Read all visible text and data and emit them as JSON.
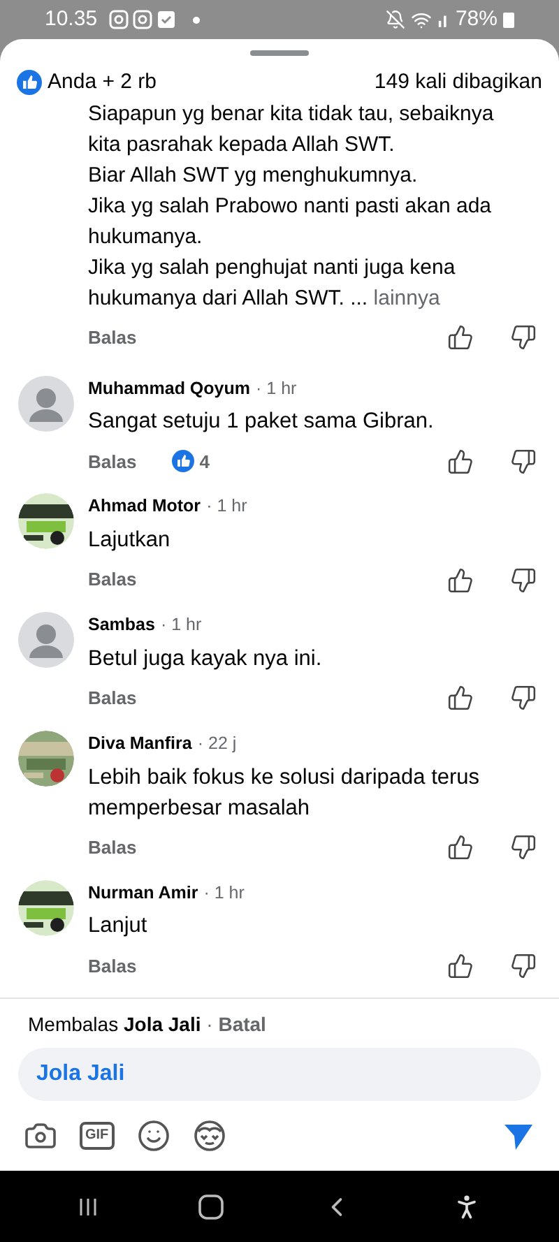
{
  "status_bar": {
    "time": "10.35",
    "battery": "78%"
  },
  "header": {
    "reactions": "Anda + 2 rb",
    "shares": "149 kali dibagikan"
  },
  "comments": [
    {
      "kind": "continued",
      "text": "Siapapun yg benar kita tidak tau, sebaiknya\nkita pasrahak kepada Allah SWT.\nBiar Allah SWT yg menghukumnya.\nJika yg salah Prabowo nanti pasti akan ada\nhukumanya.\nJika yg salah penghujat nanti juga kena\nhukumanya dari Allah SWT. ...",
      "more": "lainnya",
      "reply": "Balas"
    },
    {
      "kind": "full",
      "author": "Muhammad Qoyum",
      "separator": "·",
      "time": "1 hr",
      "avatar": {
        "kind": "silhouette"
      },
      "text": "Sangat setuju 1 paket sama Gibran.",
      "reply": "Balas",
      "likes": "4"
    },
    {
      "kind": "full",
      "author": "Ahmad Motor",
      "separator": "·",
      "time": "1 hr",
      "text": "Lajutkan",
      "reply": "Balas"
    },
    {
      "kind": "full",
      "author": "Sambas",
      "separator": "·",
      "time": "1 hr",
      "avatar": {
        "kind": "silhouette"
      },
      "text": "Betul juga kayak nya ini.",
      "reply": "Balas"
    },
    {
      "kind": "full",
      "author": "Diva Manfira",
      "separator": "·",
      "time": "22 j",
      "text": "Lebih baik fokus ke solusi daripada terus\nmemperbesar masalah",
      "reply": "Balas"
    },
    {
      "kind": "full",
      "author": "Nurman Amir",
      "separator": "·",
      "time": "1 hr",
      "text": "Lanjut",
      "reply": "Balas"
    }
  ],
  "replying": {
    "prefix": "Membalas",
    "name": "Jola Jali",
    "separator": "·",
    "cancel": "Batal"
  },
  "input": {
    "value": "Jola Jali"
  },
  "composer": {
    "gif": "GIF"
  }
}
